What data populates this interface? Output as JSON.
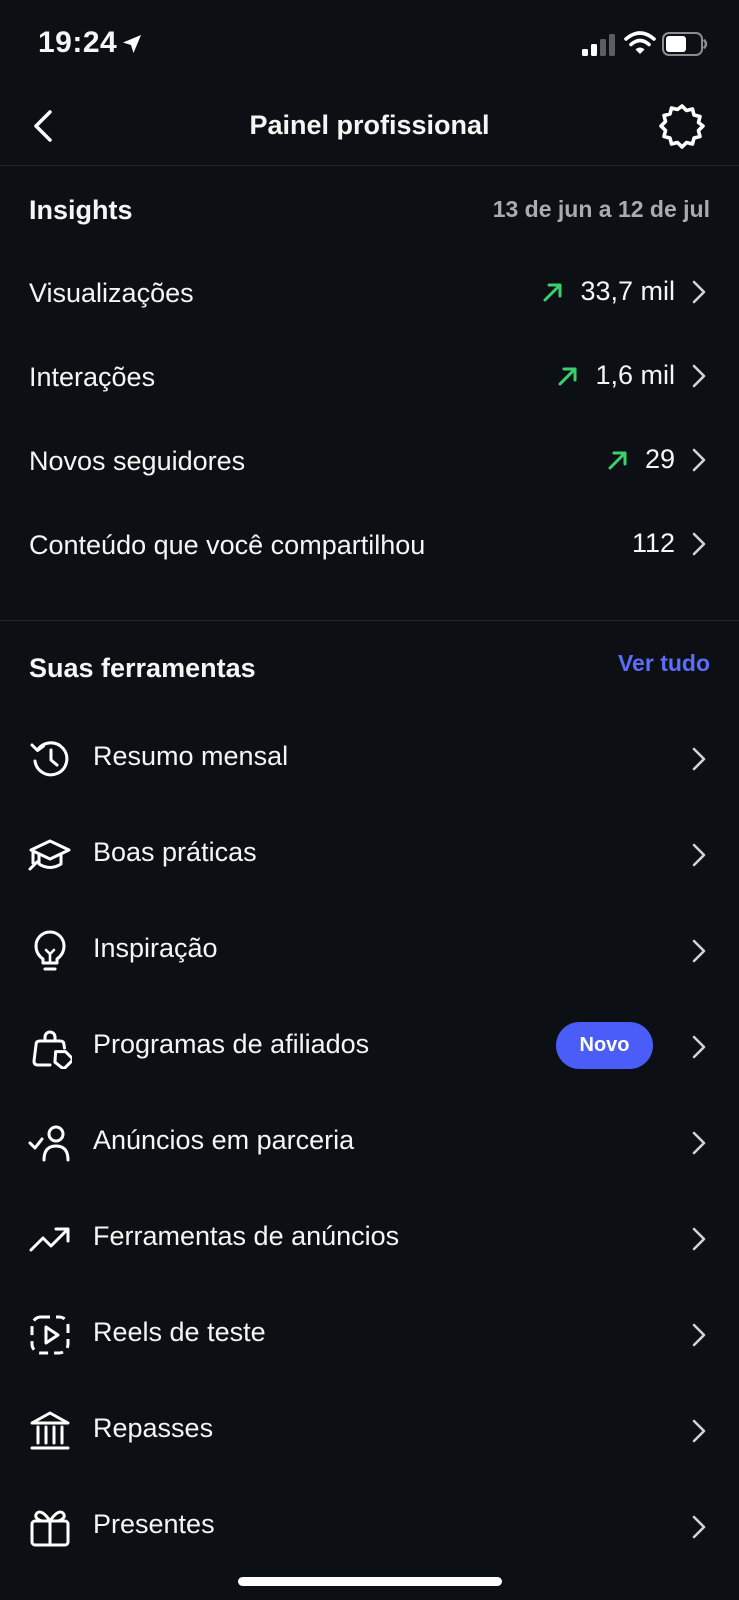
{
  "status_bar": {
    "time": "19:24"
  },
  "header": {
    "title": "Painel profissional"
  },
  "insights": {
    "title": "Insights",
    "date_range": "13 de jun a 12 de jul",
    "rows": [
      {
        "label": "Visualizações",
        "value": "33,7 mil",
        "trend": "up"
      },
      {
        "label": "Interações",
        "value": "1,6 mil",
        "trend": "up"
      },
      {
        "label": "Novos seguidores",
        "value": "29",
        "trend": "up"
      },
      {
        "label": "Conteúdo que você compartilhou",
        "value": "112",
        "trend": "none"
      }
    ]
  },
  "tools": {
    "title": "Suas ferramentas",
    "see_all": "Ver tudo",
    "items": [
      {
        "label": "Resumo mensal",
        "icon": "history-icon"
      },
      {
        "label": "Boas práticas",
        "icon": "graduation-cap-icon"
      },
      {
        "label": "Inspiração",
        "icon": "lightbulb-icon"
      },
      {
        "label": "Programas de afiliados",
        "icon": "shopping-bag-tag-icon",
        "badge": "Novo"
      },
      {
        "label": "Anúncios em parceria",
        "icon": "user-check-icon"
      },
      {
        "label": "Ferramentas de anúncios",
        "icon": "trending-up-icon"
      },
      {
        "label": "Reels de teste",
        "icon": "reels-test-icon"
      },
      {
        "label": "Repasses",
        "icon": "bank-icon"
      },
      {
        "label": "Presentes",
        "icon": "gift-icon"
      }
    ]
  },
  "colors": {
    "background": "#0c1014",
    "accent": "#4a5df9",
    "link": "#5b6dfa",
    "trend_up": "#3ccf6e",
    "muted": "#a8abb0"
  }
}
